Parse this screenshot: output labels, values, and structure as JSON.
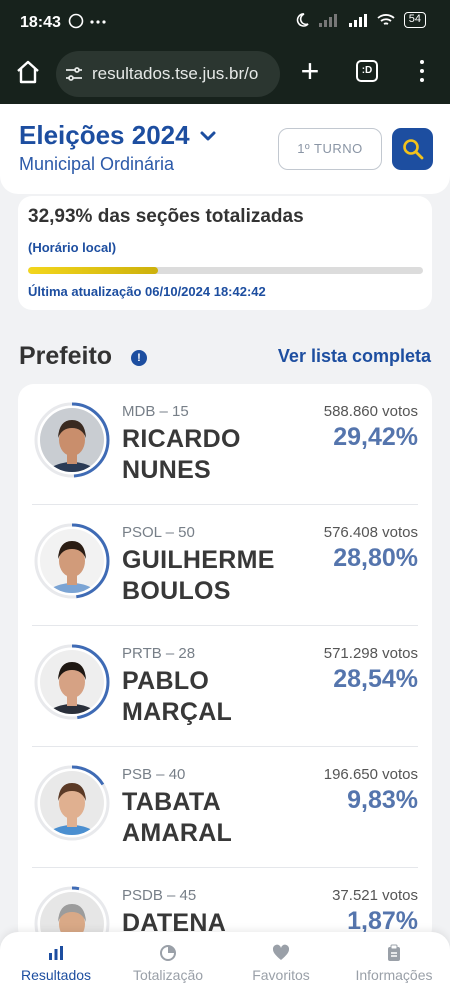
{
  "status_bar": {
    "time": "18:43",
    "battery": "54"
  },
  "browser": {
    "url": "resultados.tse.jus.br/o",
    "tabs_label": ":D"
  },
  "header": {
    "title": "Eleições 2024",
    "subtitle": "Municipal Ordinária",
    "turno_button": "1º TURNO"
  },
  "progress": {
    "headline": "32,93% das seções totalizadas",
    "local_time_label": "(Horário local)",
    "fraction": 0.3293,
    "last_update": "Última atualização 06/10/2024 18:42:42"
  },
  "section": {
    "title": "Prefeito",
    "link": "Ver lista completa"
  },
  "candidates": [
    {
      "party": "MDB – 15",
      "name_line1": "RICARDO",
      "name_line2": "NUNES",
      "votes": "588.860 votos",
      "percent": "29,42%",
      "share": 0.2942,
      "bg": "#c9cdd2",
      "hair": "#3a2a20",
      "skin": "#c98e6c",
      "shirt": "#2b3b55"
    },
    {
      "party": "PSOL – 50",
      "name_line1": "GUILHERME",
      "name_line2": "BOULOS",
      "votes": "576.408 votos",
      "percent": "28,80%",
      "share": 0.288,
      "bg": "#f2f2f2",
      "hair": "#2b1d14",
      "skin": "#d19b7a",
      "shirt": "#7ba4d4"
    },
    {
      "party": "PRTB – 28",
      "name_line1": "PABLO",
      "name_line2": "MARÇAL",
      "votes": "571.298 votos",
      "percent": "28,54%",
      "share": 0.2854,
      "bg": "#eeeeee",
      "hair": "#1e1712",
      "skin": "#d6a284",
      "shirt": "#2a2f3a"
    },
    {
      "party": "PSB – 40",
      "name_line1": "TABATA",
      "name_line2": "AMARAL",
      "votes": "196.650 votos",
      "percent": "9,83%",
      "share": 0.0983,
      "bg": "#e9e9e9",
      "hair": "#5b3a26",
      "skin": "#e0b090",
      "shirt": "#4b8fd0"
    },
    {
      "party": "PSDB – 45",
      "name_line1": "DATENA",
      "name_line2": "",
      "votes": "37.521 votos",
      "percent": "1,87%",
      "share": 0.0187,
      "bg": "#e6e6e6",
      "hair": "#9c9c9c",
      "skin": "#d9a987",
      "shirt": "#3a3f4a"
    }
  ],
  "nav": [
    {
      "label": "Resultados",
      "icon": "bar-chart-icon",
      "active": true
    },
    {
      "label": "Totalização",
      "icon": "pie-chart-icon",
      "active": false
    },
    {
      "label": "Favoritos",
      "icon": "heart-icon",
      "active": false
    },
    {
      "label": "Informações",
      "icon": "clipboard-icon",
      "active": false
    }
  ],
  "colors": {
    "brand": "#1d4ea0",
    "percent": "#5575ad",
    "progress": "#e6c817"
  }
}
